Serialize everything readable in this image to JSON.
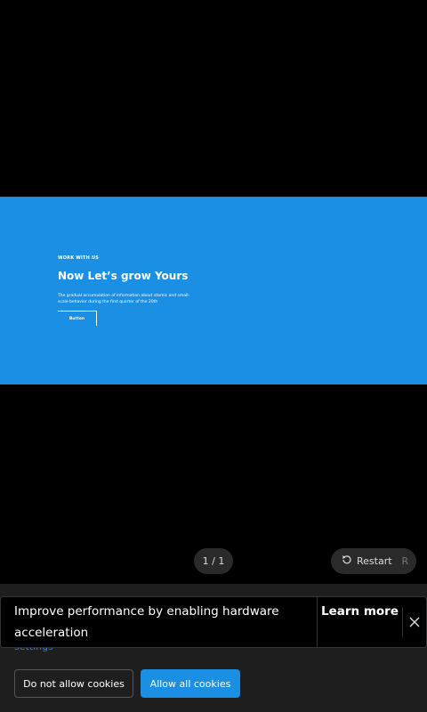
{
  "slide": {
    "eyebrow": "WORK WITH US",
    "headline": "Now Let’s grow Yours",
    "body": "The gradual accumulation of information about atomic and small-scale behavior during the first quarter of the 20th",
    "button_label": "Button",
    "background_color": "#1a8fe3"
  },
  "player": {
    "pager": "1 / 1",
    "restart_label": "Restart",
    "restart_key": "R",
    "restart_icon": "restart-icon"
  },
  "cookie_banner": {
    "settings_link": "settings",
    "deny_label": "Do not allow cookies",
    "allow_label": "Allow all cookies",
    "accent_color": "#1a8fe3"
  },
  "toast": {
    "message": "Improve performance by enabling hardware acceleration",
    "learn_more": "Learn more",
    "close_icon": "close-icon"
  }
}
